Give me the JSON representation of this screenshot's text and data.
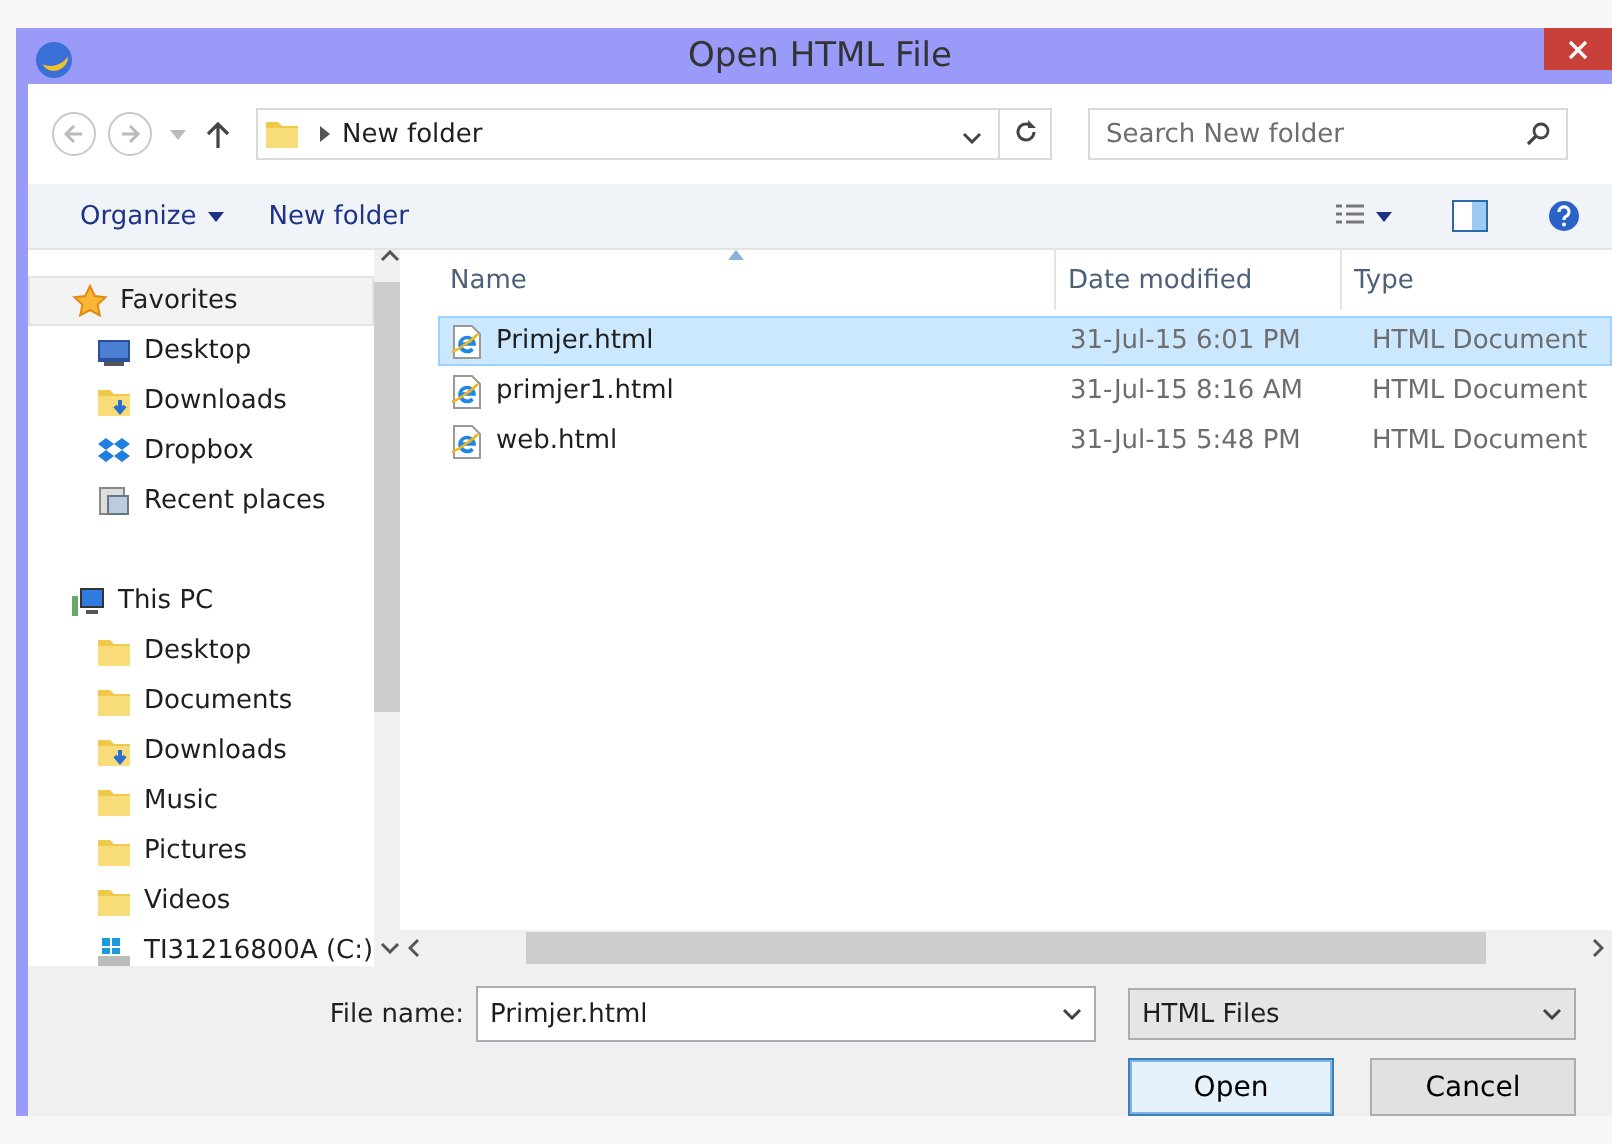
{
  "window": {
    "title": "Open HTML File"
  },
  "address_bar": {
    "path": "New folder"
  },
  "search": {
    "placeholder": "Search New folder"
  },
  "toolbar": {
    "organize": "Organize",
    "new_folder": "New folder"
  },
  "sidebar": {
    "items": [
      {
        "label": "Favorites",
        "kind": "star",
        "selected": true,
        "children": [
          {
            "label": "Desktop",
            "kind": "desktop",
            "selected": false
          },
          {
            "label": "Downloads",
            "kind": "downloads",
            "selected": false
          },
          {
            "label": "Dropbox",
            "kind": "dropbox",
            "selected": false
          },
          {
            "label": "Recent places",
            "kind": "recent",
            "selected": false
          }
        ]
      },
      {
        "label": "This PC",
        "kind": "pc",
        "selected": false,
        "children": [
          {
            "label": "Desktop",
            "kind": "folder",
            "selected": false
          },
          {
            "label": "Documents",
            "kind": "folder",
            "selected": false
          },
          {
            "label": "Downloads",
            "kind": "downloads",
            "selected": false
          },
          {
            "label": "Music",
            "kind": "folder",
            "selected": false
          },
          {
            "label": "Pictures",
            "kind": "folder",
            "selected": false
          },
          {
            "label": "Videos",
            "kind": "folder",
            "selected": false
          },
          {
            "label": "TI31216800A (C:)",
            "kind": "drive",
            "selected": false
          }
        ]
      }
    ]
  },
  "table": {
    "columns": [
      {
        "label": "Name",
        "sorted": true
      },
      {
        "label": "Date modified",
        "sorted": false
      },
      {
        "label": "Type",
        "sorted": false
      }
    ],
    "rows": [
      {
        "name": "Primjer.html",
        "date": "31-Jul-15 6:01 PM",
        "type": "HTML Document",
        "selected": true
      },
      {
        "name": "primjer1.html",
        "date": "31-Jul-15 8:16 AM",
        "type": "HTML Document",
        "selected": false
      },
      {
        "name": "web.html",
        "date": "31-Jul-15 5:48 PM",
        "type": "HTML Document",
        "selected": false
      }
    ]
  },
  "file_name": {
    "label": "File name:",
    "value": "Primjer.html"
  },
  "file_type": {
    "value": "HTML Files"
  },
  "buttons": [
    {
      "label": "Open",
      "kind": "default"
    },
    {
      "label": "Cancel",
      "kind": "normal"
    }
  ]
}
